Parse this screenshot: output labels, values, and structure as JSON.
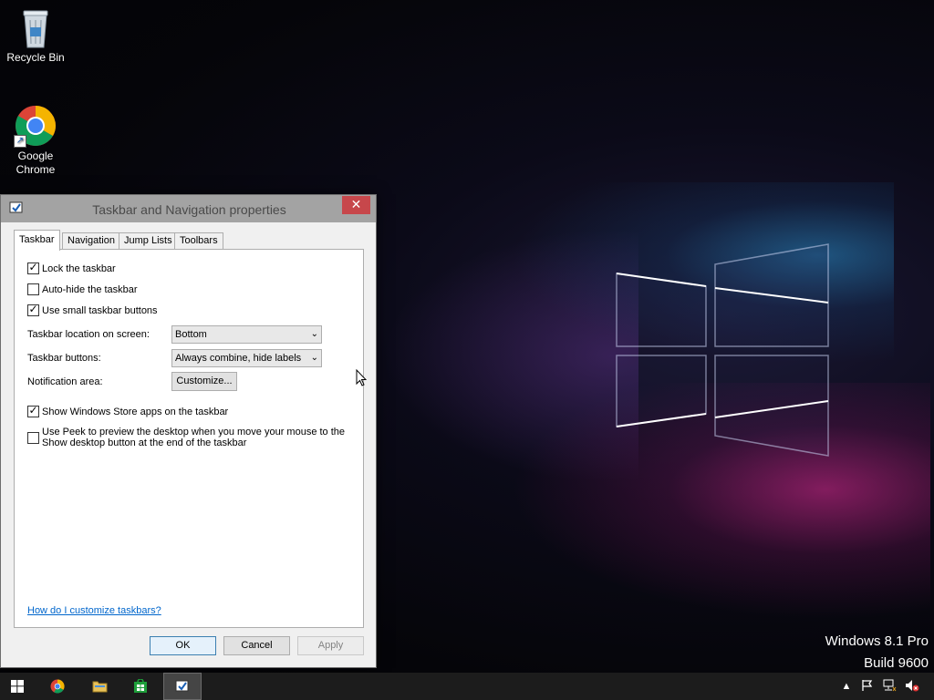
{
  "desktop": {
    "icons": [
      {
        "label": "Recycle Bin"
      },
      {
        "label": "Google Chrome"
      }
    ],
    "watermark": {
      "line1": "Windows 8.1 Pro",
      "line2": "Build 9600"
    }
  },
  "dialog": {
    "title": "Taskbar and Navigation properties",
    "close_label": "✕",
    "tabs": [
      {
        "label": "Taskbar",
        "active": true
      },
      {
        "label": "Navigation"
      },
      {
        "label": "Jump Lists"
      },
      {
        "label": "Toolbars"
      }
    ],
    "options": {
      "lock_taskbar": {
        "label": "Lock the taskbar",
        "checked": true
      },
      "auto_hide": {
        "label": "Auto-hide the taskbar",
        "checked": false
      },
      "small_buttons": {
        "label": "Use small taskbar buttons",
        "checked": true
      },
      "store_apps": {
        "label": "Show Windows Store apps on the taskbar",
        "checked": true
      },
      "peek": {
        "label_line1": "Use Peek to preview the desktop when you move your mouse to the",
        "label_line2": "Show desktop button at the end of the taskbar",
        "checked": false
      }
    },
    "fields": {
      "location_label": "Taskbar location on screen:",
      "location_value": "Bottom",
      "buttons_label": "Taskbar buttons:",
      "buttons_value": "Always combine, hide labels",
      "notification_label": "Notification area:",
      "customize_label": "Customize..."
    },
    "help_link": "How do I customize taskbars?",
    "buttons": {
      "ok": "OK",
      "cancel": "Cancel",
      "apply": "Apply"
    },
    "check_glyph": "✓"
  },
  "taskbar": {
    "items": [
      "start",
      "chrome",
      "file-explorer",
      "store",
      "taskbar-properties"
    ],
    "tray": [
      "show-hidden-icons",
      "action-center",
      "network",
      "volume-muted"
    ],
    "accent_color": "#1c1c1c"
  }
}
